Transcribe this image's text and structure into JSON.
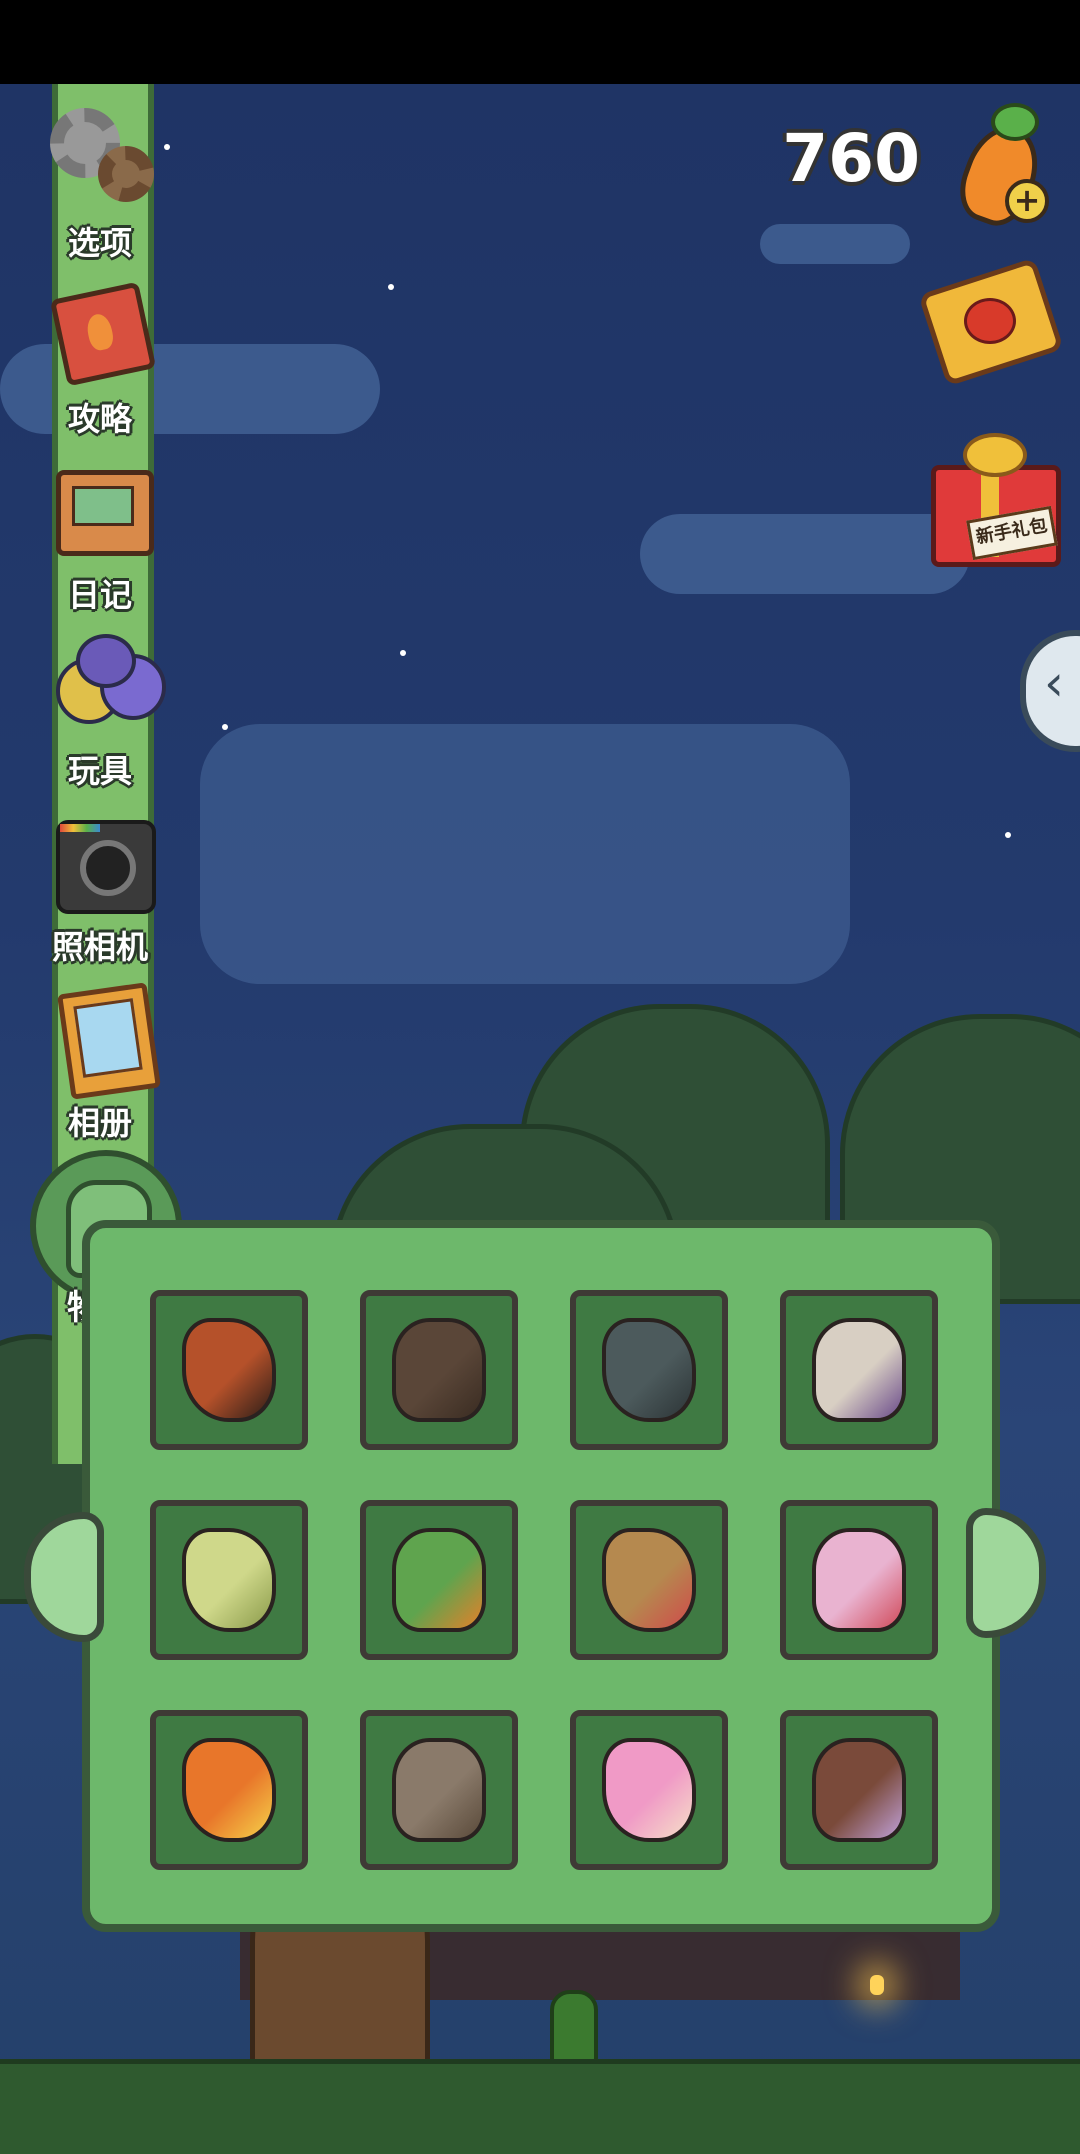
{
  "currency": {
    "carrot_count": "760"
  },
  "sidebar": {
    "items": [
      {
        "label": "选项",
        "icon": "gear-icon"
      },
      {
        "label": "攻略",
        "icon": "guidebook-icon"
      },
      {
        "label": "日记",
        "icon": "diary-icon"
      },
      {
        "label": "玩具",
        "icon": "toy-balls-icon"
      },
      {
        "label": "照相机",
        "icon": "camera-icon"
      },
      {
        "label": "相册",
        "icon": "album-icon"
      }
    ],
    "active": {
      "label": "物品",
      "icon": "backpack-icon"
    }
  },
  "top_right": {
    "ticket_icon": "lottery-ticket-icon",
    "gift_label": "新手礼包",
    "gift_icon": "gift-box-icon",
    "expand_icon": "chevron-left-icon"
  },
  "inventory": {
    "items": [
      {
        "name": "lionfish-icon",
        "colors": [
          "#b5512a",
          "#2b1d18"
        ]
      },
      {
        "name": "flatfish-icon",
        "colors": [
          "#5a4638",
          "#3a2c22"
        ]
      },
      {
        "name": "catfish-icon",
        "colors": [
          "#4c5a5c",
          "#2c3436"
        ]
      },
      {
        "name": "cupcake-icon",
        "colors": [
          "#d8cfc3",
          "#6a4a8a"
        ]
      },
      {
        "name": "pufferfish-icon",
        "colors": [
          "#cfd88a",
          "#8a9a4a"
        ]
      },
      {
        "name": "lord-of-the-carrots-book-icon",
        "colors": [
          "#5fa44e",
          "#e4802a"
        ]
      },
      {
        "name": "wool-hat-icon",
        "colors": [
          "#b5894f",
          "#d04a4a"
        ]
      },
      {
        "name": "crepe-icon",
        "colors": [
          "#e9b3d0",
          "#d04a5a"
        ]
      },
      {
        "name": "sunscreen-icon",
        "colors": [
          "#e8762a",
          "#f6d24a"
        ]
      },
      {
        "name": "yarn-ball-icon",
        "colors": [
          "#8a7a6a",
          "#5a4a3a"
        ]
      },
      {
        "name": "cotton-candy-icon",
        "colors": [
          "#f09ac6",
          "#f6e0c8"
        ]
      },
      {
        "name": "chocolate-cupcake-icon",
        "colors": [
          "#7a4a3a",
          "#c0a0d8"
        ]
      }
    ]
  }
}
